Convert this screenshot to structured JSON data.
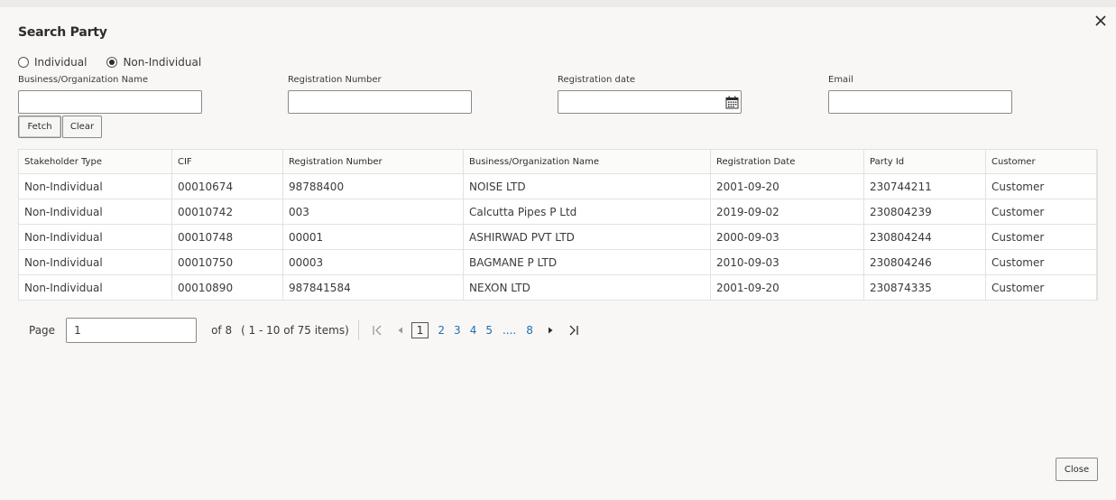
{
  "dialog": {
    "title": "Search Party",
    "close_label": "Close"
  },
  "radios": [
    {
      "label": "Individual",
      "checked": false
    },
    {
      "label": "Non-Individual",
      "checked": true
    }
  ],
  "fields": {
    "business_name": {
      "label": "Business/Organization Name",
      "value": ""
    },
    "registration_number": {
      "label": "Registration Number",
      "value": ""
    },
    "registration_date": {
      "label": "Registration date",
      "value": ""
    },
    "email": {
      "label": "Email",
      "value": ""
    }
  },
  "buttons": {
    "fetch": "Fetch",
    "clear": "Clear"
  },
  "table": {
    "headers": [
      "Stakeholder Type",
      "CIF",
      "Registration Number",
      "Business/Organization Name",
      "Registration Date",
      "Party Id",
      "Customer"
    ],
    "rows": [
      [
        "Non-Individual",
        "00010674",
        "98788400",
        "NOISE LTD",
        "2001-09-20",
        "230744211",
        "Customer"
      ],
      [
        "Non-Individual",
        "00010742",
        "003",
        "Calcutta Pipes P Ltd",
        "2019-09-02",
        "230804239",
        "Customer"
      ],
      [
        "Non-Individual",
        "00010748",
        "00001",
        "ASHIRWAD PVT LTD",
        "2000-09-03",
        "230804244",
        "Customer"
      ],
      [
        "Non-Individual",
        "00010750",
        "00003",
        "BAGMANE P LTD",
        "2010-09-03",
        "230804246",
        "Customer"
      ],
      [
        "Non-Individual",
        "00010890",
        "987841584",
        "NEXON LTD",
        "2001-09-20",
        "230874335",
        "Customer"
      ]
    ]
  },
  "pagination": {
    "page_label": "Page",
    "page_value": "1",
    "of_text": "of 8",
    "items_text": "( 1 - 10 of 75 items)",
    "pages": [
      "1",
      "2",
      "3",
      "4",
      "5"
    ],
    "ellipsis": "....",
    "last_page": "8"
  },
  "icons": {
    "close": "close-icon",
    "calendar": "calendar-icon",
    "first": "first-page-icon",
    "prev": "previous-page-icon",
    "next": "next-page-icon",
    "last": "last-page-icon"
  }
}
